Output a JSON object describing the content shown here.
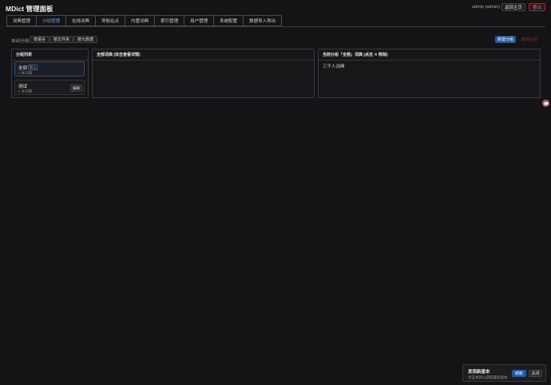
{
  "app": {
    "title": "MDict 管理面板",
    "user": "admin (admin)",
    "home_label": "返回主页",
    "logout_label": "登出"
  },
  "tabs": [
    {
      "label": "词典管理"
    },
    {
      "label": "分组管理",
      "active": true
    },
    {
      "label": "在线词典"
    },
    {
      "label": "导航站点"
    },
    {
      "label": "内置词典"
    },
    {
      "label": "索引管理"
    },
    {
      "label": "用户管理"
    },
    {
      "label": "系统配置"
    },
    {
      "label": "数据导入导出"
    }
  ],
  "toolbar": {
    "auto_group_label": "自动分组:",
    "by_language": "按语言",
    "by_folder": "按文件夹",
    "by_metadata": "按元数据",
    "new_group": "新建分组",
    "delete_group": "删除分组"
  },
  "group_list": {
    "header": "分组列表",
    "items": [
      {
        "name": "全部",
        "badge": "默认",
        "count": "1 本词典",
        "selected": true
      },
      {
        "name": "测试",
        "count": "1 本词典",
        "edit_label": "编辑"
      }
    ]
  },
  "all_dicts": {
    "header": "全部词典 (双击查看详情)"
  },
  "current_group": {
    "header": "当前分组「全部」词典 (点击 ✕ 移除)",
    "items": [
      "三千人词典"
    ]
  },
  "update_notice": {
    "title": "发现新版本",
    "description": "点击更新以获取最新版本",
    "refresh_label": "刷新",
    "close_label": "关闭"
  },
  "colors": {
    "accent": "#1f5aa8",
    "active_tab": "#5aa0e8",
    "danger": "#e26a6a",
    "background": "#141416"
  },
  "icons": {
    "floating": "chat-bubble-icon"
  }
}
